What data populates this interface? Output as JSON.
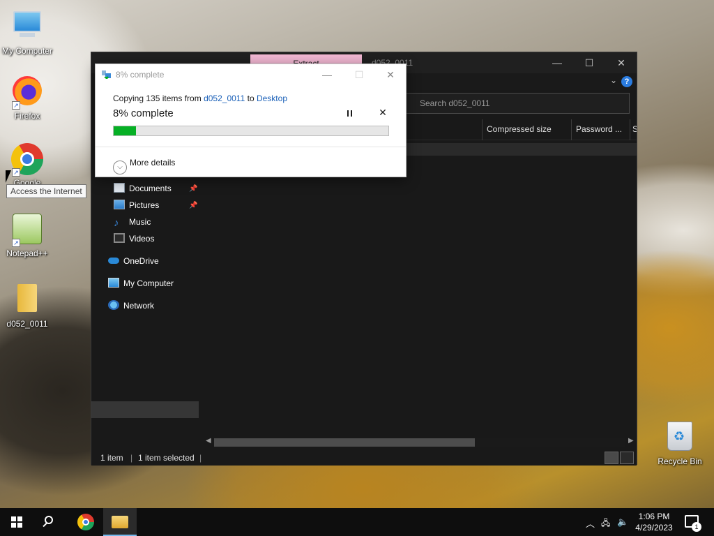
{
  "desktop": {
    "icons": [
      {
        "label": "My Computer",
        "glyph": "computer-icon"
      },
      {
        "label": "Firefox",
        "glyph": "firefox-icon"
      },
      {
        "label": "Google",
        "glyph": "chrome-icon"
      },
      {
        "label": "Notepad++",
        "glyph": "notepad-plus-plus-icon"
      },
      {
        "label": "d052_0011",
        "glyph": "folder-icon"
      },
      {
        "label": "Recycle Bin",
        "glyph": "recycle-bin-icon"
      }
    ],
    "tooltip": "Access the Internet"
  },
  "explorer": {
    "title": "d052_0011",
    "ribbon_tab": "Extract",
    "search_placeholder": "Search d052_0011",
    "columns": [
      "Compressed size",
      "Password ...",
      "Si"
    ],
    "nav": {
      "documents": "Documents",
      "pictures": "Pictures",
      "music": "Music",
      "videos": "Videos",
      "onedrive": "OneDrive",
      "my_computer": "My Computer",
      "network": "Network"
    },
    "status": {
      "items": "1 item",
      "selected": "1 item selected"
    },
    "help_label": "?"
  },
  "copy_dialog": {
    "title": "8% complete",
    "copying_prefix": "Copying 135 items from",
    "source": "d052_0011",
    "to_word": "to",
    "destination": "Desktop",
    "percent_text": "8% complete",
    "progress_fraction": 0.08,
    "more_details": "More details",
    "progress_color": "#06b025"
  },
  "taskbar": {
    "time": "1:06 PM",
    "date": "4/29/2023",
    "notification_count": "1"
  }
}
